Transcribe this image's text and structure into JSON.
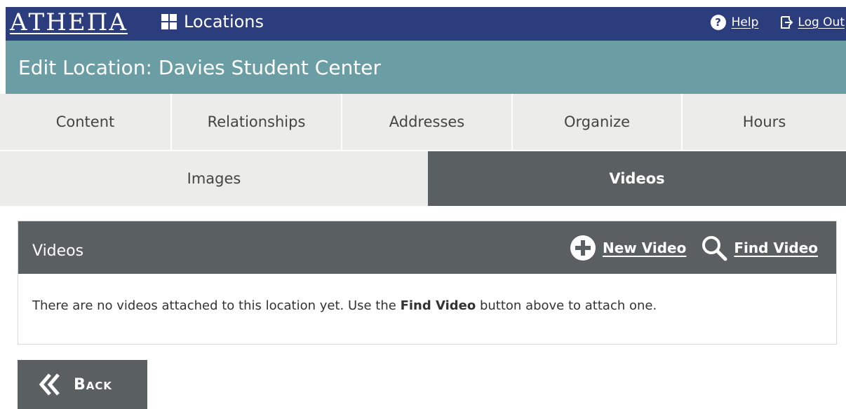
{
  "header": {
    "logo_text": "ΑΤΗΕΠΑ",
    "nav_label": "Locations",
    "help_label": "Help",
    "logout_label": "Log Out"
  },
  "title_bar": {
    "title": "Edit Location: Davies Student Center"
  },
  "tabs": {
    "row1": [
      {
        "label": "Content",
        "active": false
      },
      {
        "label": "Relationships",
        "active": false
      },
      {
        "label": "Addresses",
        "active": false
      },
      {
        "label": "Organize",
        "active": false
      },
      {
        "label": "Hours",
        "active": false
      }
    ],
    "row2": [
      {
        "label": "Images",
        "active": false
      },
      {
        "label": "Videos",
        "active": true
      }
    ]
  },
  "panel": {
    "title": "Videos",
    "new_label": "New Video",
    "find_label": "Find Video",
    "message_before": "There are no videos attached to this location yet. Use the ",
    "message_bold": "Find Video",
    "message_after": " button above to attach one."
  },
  "back_label": "Back",
  "colors": {
    "header_bg": "#2c3d7e",
    "title_bg": "#6b9ea4",
    "tab_bg": "#ececea",
    "active_bg": "#5a6062"
  },
  "icons": {
    "help": "help-icon",
    "logout": "logout-icon",
    "grid": "grid-icon",
    "plus": "plus-circle-icon",
    "search": "search-icon",
    "back": "double-chevron-left-icon"
  }
}
